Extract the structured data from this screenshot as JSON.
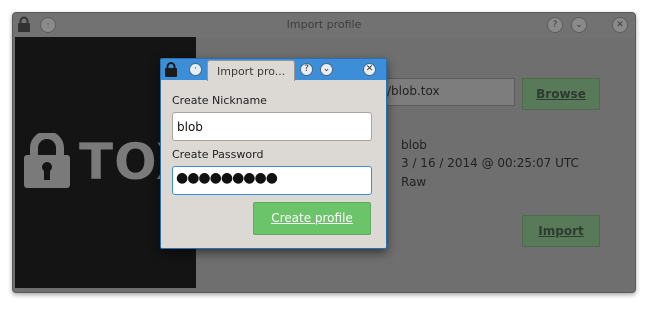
{
  "background_window": {
    "title": "Import profile",
    "logo_text": "TOX",
    "path_value": "/blob.tox",
    "browse_label": "Browse",
    "import_label": "Import",
    "profile_info": {
      "name": "blob",
      "date": "3 / 16 / 2014 @ 00:25:07 UTC",
      "type": "Raw"
    }
  },
  "dialog": {
    "title": "Import pro...",
    "nickname_label": "Create Nickname",
    "nickname_value": "blob",
    "password_label": "Create Password",
    "password_mask": "●●●●●●●●●",
    "create_label": "Create profile",
    "help_glyph": "?",
    "minimize_glyph": "⌄",
    "close_glyph": "✕"
  },
  "colors": {
    "titlebar_accent": "#3c8ed8",
    "create_button": "#6bc36a",
    "dimmed_button": "#587a59"
  },
  "icons": [
    "lock-icon",
    "help-icon",
    "minimize-icon",
    "close-icon"
  ]
}
